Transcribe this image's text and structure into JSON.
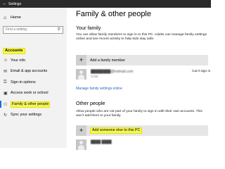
{
  "window": {
    "title": "Settings",
    "back_glyph": "←"
  },
  "sidebar": {
    "home": {
      "label": "Home",
      "icon": "home-icon",
      "glyph": "⌂"
    },
    "search": {
      "placeholder": "Find a setting",
      "icon": "search-icon",
      "glyph": "⚲"
    },
    "section_label": "Accounts",
    "items": [
      {
        "label": "Your info",
        "icon": "person-icon",
        "glyph": "☺",
        "active": false
      },
      {
        "label": "Email & app accounts",
        "icon": "mail-icon",
        "glyph": "✉",
        "active": false
      },
      {
        "label": "Sign-in options",
        "icon": "key-icon",
        "glyph": "⚿",
        "active": false
      },
      {
        "label": "Access work or school",
        "icon": "briefcase-icon",
        "glyph": "▣",
        "active": false
      },
      {
        "label": "Family & other people",
        "icon": "people-icon",
        "glyph": "⚇",
        "active": true
      },
      {
        "label": "Sync your settings",
        "icon": "sync-icon",
        "glyph": "↻",
        "active": false
      }
    ]
  },
  "main": {
    "title": "Family & other people",
    "family": {
      "heading": "Your family",
      "description": "You can allow family members to sign in to this PC. Adults can manage family settings online and see recent activity to help kids stay safe.",
      "add_label": "Add a family member",
      "member": {
        "email": "████████@hotmail.com",
        "role": "Child",
        "status": "Can't sign in"
      },
      "manage_link": "Manage family settings online"
    },
    "other": {
      "heading": "Other people",
      "description": "Allow people who are not part of your family to sign in with their own accounts. This won't add them to your family.",
      "add_label": "Add someone else to this PC",
      "partial_user": "████ ████"
    }
  },
  "colors": {
    "titlebar": "#2b2b2b",
    "sidebar_bg": "#f2f2f2",
    "accent": "#1e6ed4",
    "highlight": "#f5f75a",
    "link": "#2466c9"
  }
}
